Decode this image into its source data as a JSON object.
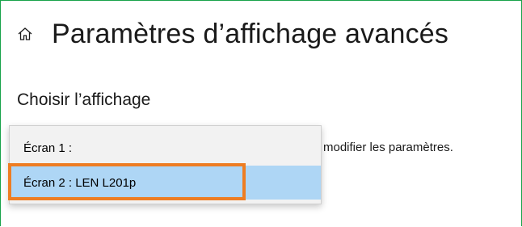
{
  "header": {
    "icon": "home-icon",
    "title": "Paramètres d’affichage avancés"
  },
  "section": {
    "heading": "Choisir l’affichage"
  },
  "hint": {
    "text": "modifier les paramètres."
  },
  "display_dropdown": {
    "options": [
      {
        "label": "Écran 1 :"
      },
      {
        "label": "Écran 2 : LEN L201p",
        "selected": true
      }
    ]
  },
  "colors": {
    "window_border": "#19a34a",
    "selected_option_bg": "#aed6f5",
    "dropdown_bg": "#f2f2f2",
    "highlight_border": "#ee7d22"
  }
}
